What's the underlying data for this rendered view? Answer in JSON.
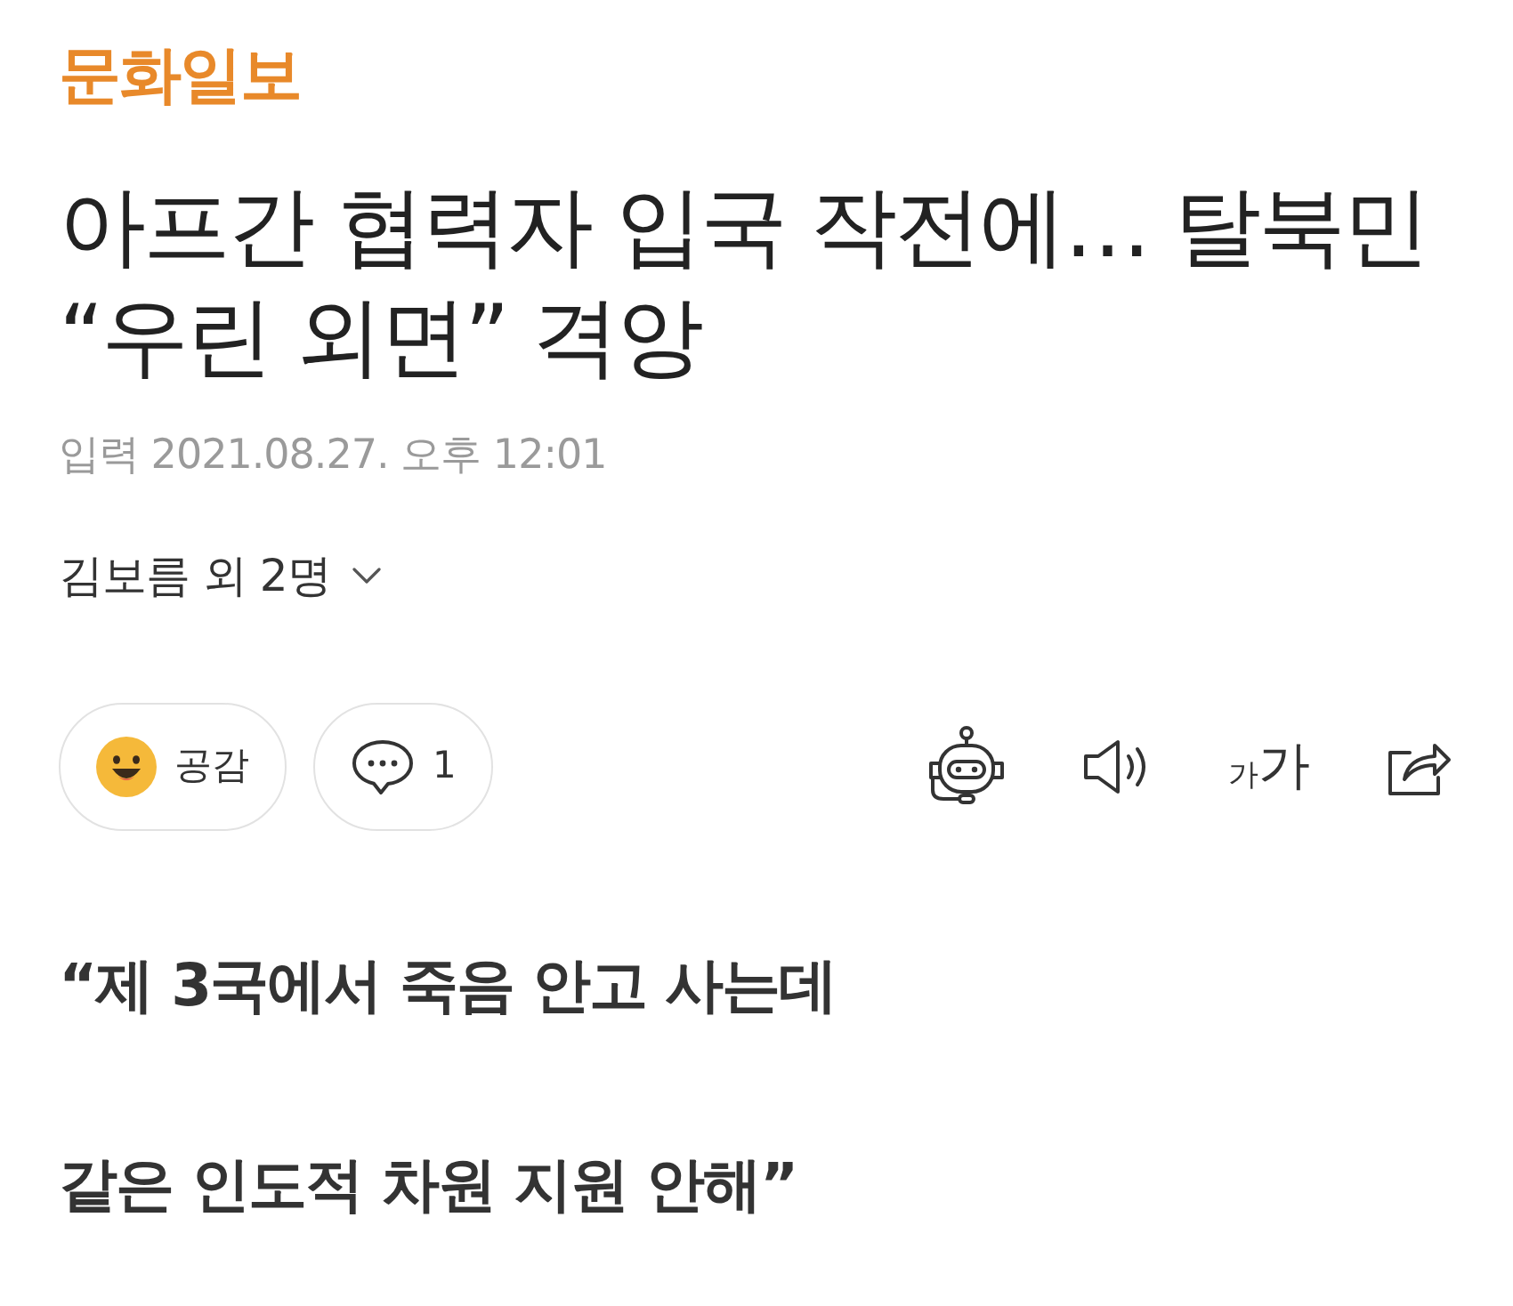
{
  "publisher": {
    "logo": "문화일보"
  },
  "headline_lines": [
    "아프간 협력자 입국 작전에… 탈북민",
    "“우린 외면” 격앙"
  ],
  "published": "입력 2021.08.27. 오후 12:01",
  "authors": {
    "label": "김보름 외 2명",
    "expanded": false
  },
  "reactions": [
    {
      "kind": "empathy",
      "label": "공감"
    },
    {
      "kind": "comment",
      "label": "1"
    }
  ],
  "tools": [
    {
      "kind": "summary"
    },
    {
      "kind": "audio"
    },
    {
      "kind": "font_size",
      "small": "가",
      "large": "가"
    },
    {
      "kind": "share"
    }
  ],
  "subheading_lines": [
    "“제 3국에서 죽음 안고 사는데",
    "같은 인도적 차원 지원 안해”"
  ]
}
